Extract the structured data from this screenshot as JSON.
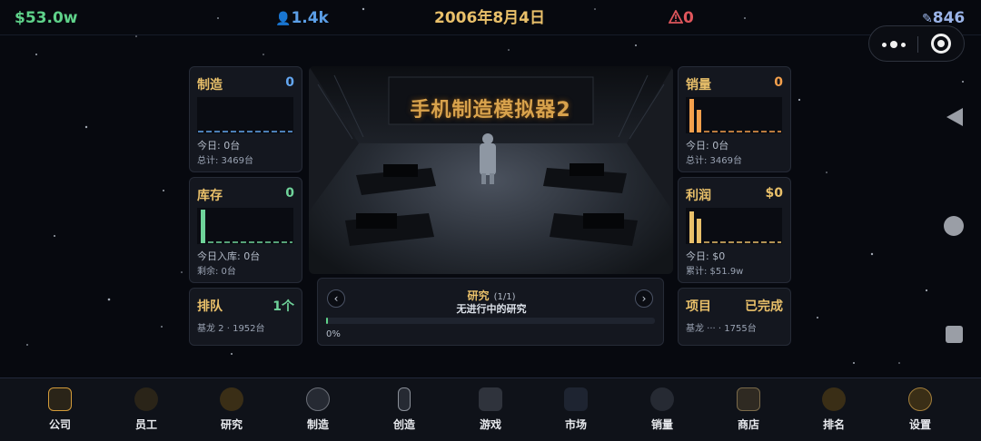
{
  "status": {
    "money": "$53.0w",
    "staff": "1.4k",
    "date": "2006年8月4日",
    "alerts": "0",
    "score": "846"
  },
  "panels": {
    "manufacture": {
      "title": "制造",
      "value": "0",
      "line1": "今日: 0台",
      "line2": "总计: 3469台",
      "color": "#63a6f0"
    },
    "inventory": {
      "title": "库存",
      "value": "0",
      "line1": "今日入库: 0台",
      "line2": "剩余: 0台",
      "color": "#6fd39a"
    },
    "queue": {
      "title": "排队",
      "value": "1个",
      "line1": "基龙 2 · 1952台",
      "color": "#6fd39a"
    },
    "sales": {
      "title": "销量",
      "value": "0",
      "line1": "今日: 0台",
      "line2": "总计: 3469台",
      "color": "#f4a04c"
    },
    "profit": {
      "title": "利润",
      "value": "$0",
      "line1": "今日: $0",
      "line2": "累计: $51.9w",
      "color": "#e9c06a"
    },
    "project": {
      "title": "项目",
      "value": "已完成",
      "line1": "基龙 ··· · 1755台",
      "color": "#e9c06a"
    }
  },
  "scene": {
    "title": "手机制造模拟器2"
  },
  "research": {
    "title": "研究",
    "count": "(1/1)",
    "status": "无进行中的研究",
    "progress": 0,
    "progress_label": "0%"
  },
  "nav": [
    {
      "label": "公司",
      "icon": "building-icon"
    },
    {
      "label": "员工",
      "icon": "person-icon"
    },
    {
      "label": "研究",
      "icon": "lightbulb-icon"
    },
    {
      "label": "制造",
      "icon": "gear-icon"
    },
    {
      "label": "创造",
      "icon": "phone-icon"
    },
    {
      "label": "游戏",
      "icon": "gamepad-icon"
    },
    {
      "label": "市场",
      "icon": "chart-icon"
    },
    {
      "label": "销量",
      "icon": "bag-icon"
    },
    {
      "label": "商店",
      "icon": "store-icon"
    },
    {
      "label": "排名",
      "icon": "trophy-icon"
    },
    {
      "label": "设置",
      "icon": "settings-icon"
    }
  ],
  "colors": {
    "gold": "#e9c06a",
    "green": "#5fd28a",
    "blue": "#5b9ee6",
    "red": "#e0565c",
    "orange": "#f4a04c"
  }
}
